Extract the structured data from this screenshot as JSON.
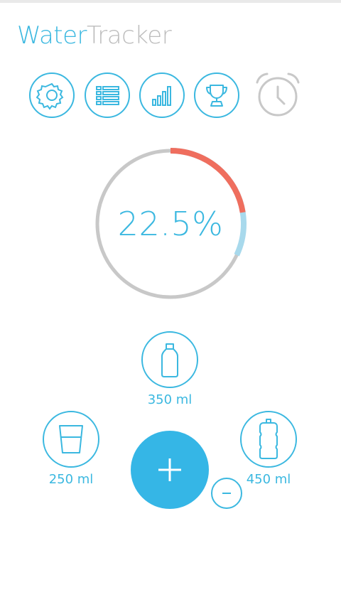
{
  "app": {
    "title_part1": "Water",
    "title_part2": "Tracker"
  },
  "toolbar": {
    "icons": [
      "gear-icon",
      "list-icon",
      "bar-chart-icon",
      "trophy-icon",
      "alarm-clock-icon"
    ]
  },
  "progress": {
    "percent_text": "22.5%",
    "fill_fraction": 0.225,
    "target_fraction": 0.32
  },
  "volumes": {
    "top": {
      "label": "350 ml",
      "icon": "small-bottle-icon"
    },
    "left": {
      "label": "250 ml",
      "icon": "glass-icon"
    },
    "right": {
      "label": "450 ml",
      "icon": "sport-bottle-icon"
    }
  },
  "actions": {
    "add_icon": "plus-icon",
    "remove_icon": "minus-icon"
  },
  "colors": {
    "accent": "#3bb8e0",
    "accent_light": "#a8d9ec",
    "progress_red": "#ef6e5e",
    "ring_gray": "#c8c8c8",
    "muted": "#bdbdbd"
  }
}
